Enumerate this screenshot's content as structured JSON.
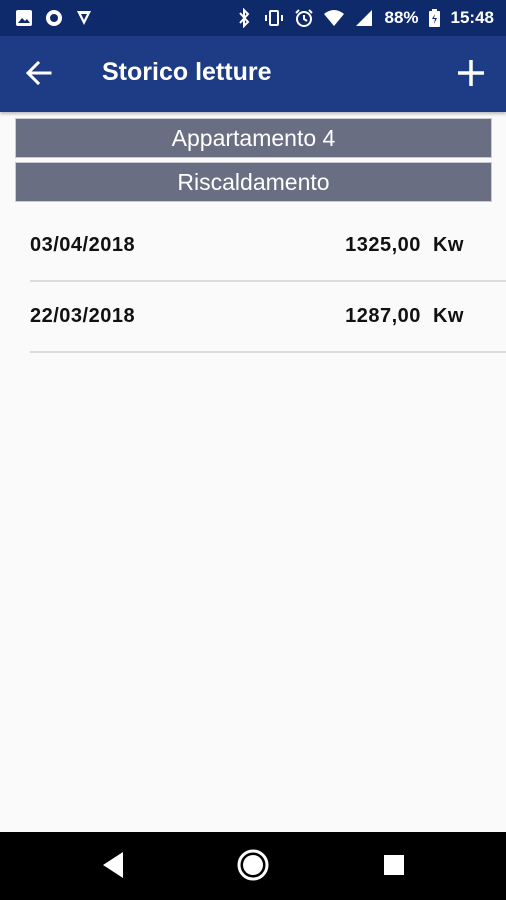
{
  "status_bar": {
    "battery_percent": "88%",
    "time": "15:48",
    "icons_left": [
      "image-icon",
      "circle-icon",
      "vpn-icon"
    ],
    "icons_right": [
      "bluetooth-icon",
      "vibrate-icon",
      "alarm-icon",
      "wifi-icon",
      "signal-icon",
      "battery-icon"
    ]
  },
  "app_bar": {
    "title": "Storico letture",
    "back_icon": "arrow-left-icon",
    "add_icon": "plus-icon"
  },
  "header": {
    "apartment": "Appartamento 4",
    "category": "Riscaldamento"
  },
  "readings": [
    {
      "date": "03/04/2018",
      "value": "1325,00  Kw"
    },
    {
      "date": "22/03/2018",
      "value": "1287,00  Kw"
    }
  ],
  "nav_bar": {
    "back": "triangle-back-icon",
    "home": "circle-home-icon",
    "recents": "square-recents-icon"
  },
  "colors": {
    "status_bar": "#0e2a6a",
    "app_bar": "#1d3c85",
    "header_bar": "#6a6e82",
    "background": "#fafafa"
  }
}
